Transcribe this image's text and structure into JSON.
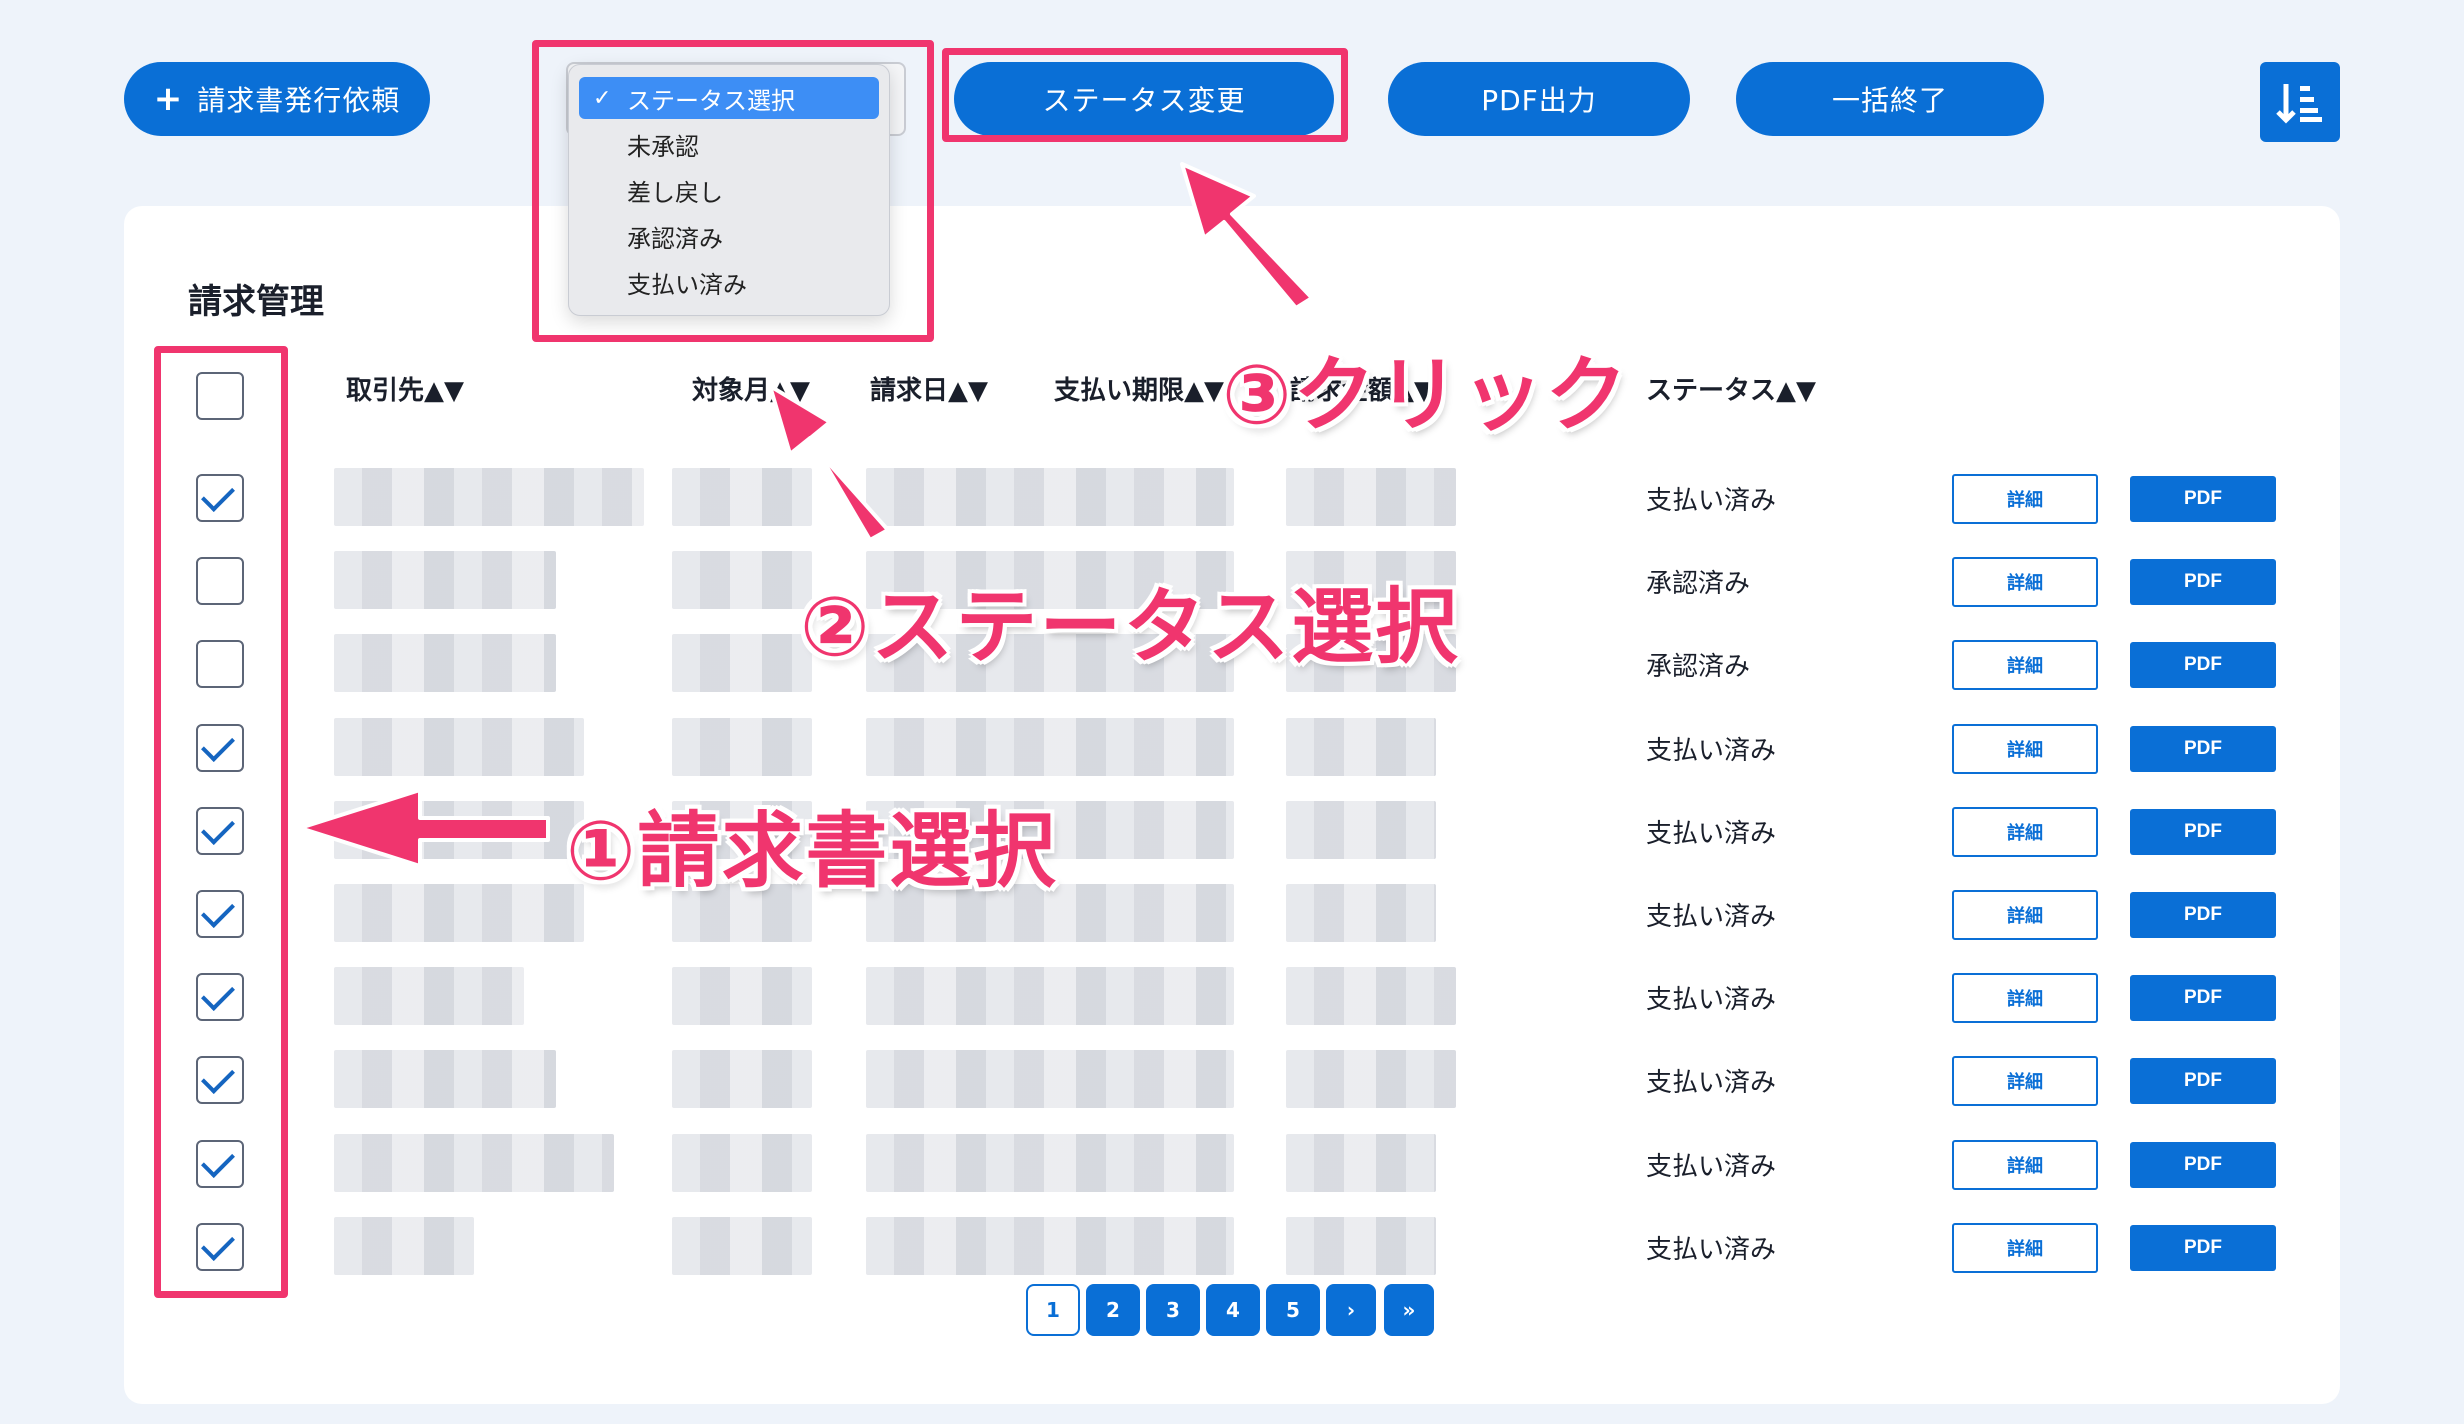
{
  "toolbar": {
    "request_button": "請求書発行依頼",
    "status_change_button": "ステータス変更",
    "pdf_output_button": "PDF出力",
    "bulk_finish_button": "一括終了"
  },
  "dropdown": {
    "options": [
      "ステータス選択",
      "未承認",
      "差し戻し",
      "承認済み",
      "支払い済み"
    ],
    "selected": "ステータス選択"
  },
  "page": {
    "title": "請求管理"
  },
  "table": {
    "headers": [
      "取引先▲▼",
      "対象月▲▼",
      "請求日▲▼",
      "支払い期限▲▼",
      "請求金額▲▼",
      "ステータス▲▼"
    ],
    "rows": [
      {
        "checked": true,
        "status": "支払い済み",
        "detail": "詳細",
        "pdf": "PDF"
      },
      {
        "checked": false,
        "status": "承認済み",
        "detail": "詳細",
        "pdf": "PDF"
      },
      {
        "checked": false,
        "status": "承認済み",
        "detail": "詳細",
        "pdf": "PDF"
      },
      {
        "checked": true,
        "status": "支払い済み",
        "detail": "詳細",
        "pdf": "PDF"
      },
      {
        "checked": true,
        "status": "支払い済み",
        "detail": "詳細",
        "pdf": "PDF"
      },
      {
        "checked": true,
        "status": "支払い済み",
        "detail": "詳細",
        "pdf": "PDF"
      },
      {
        "checked": true,
        "status": "支払い済み",
        "detail": "詳細",
        "pdf": "PDF"
      },
      {
        "checked": true,
        "status": "支払い済み",
        "detail": "詳細",
        "pdf": "PDF"
      },
      {
        "checked": true,
        "status": "支払い済み",
        "detail": "詳細",
        "pdf": "PDF"
      },
      {
        "checked": true,
        "status": "支払い済み",
        "detail": "詳細",
        "pdf": "PDF"
      }
    ]
  },
  "pagination": {
    "pages": [
      "1",
      "2",
      "3",
      "4",
      "5",
      "›",
      "»"
    ],
    "current": "1"
  },
  "annotations": {
    "step1": "①請求書選択",
    "step2": "②ステータス選択",
    "step3": "③クリック"
  },
  "colors": {
    "primary": "#0a6fd6",
    "highlight": "#f0356e",
    "background": "#eef3fa"
  }
}
